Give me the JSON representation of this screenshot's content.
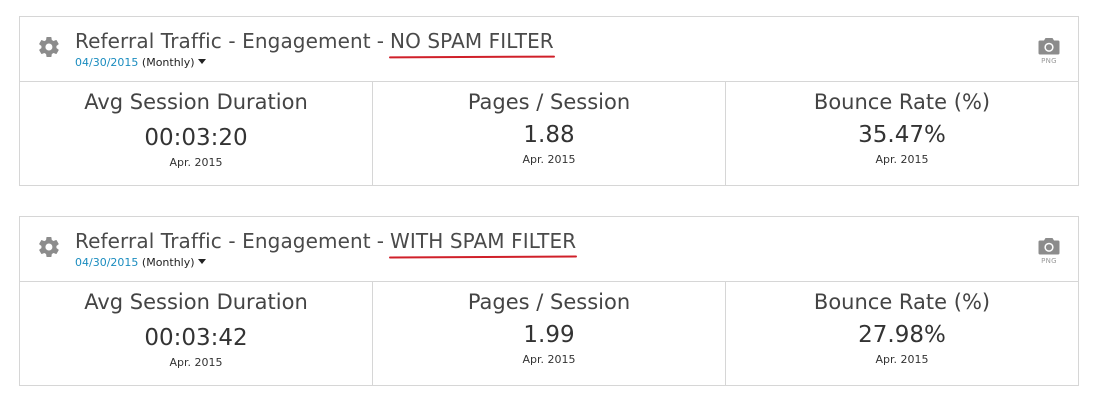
{
  "widgets": [
    {
      "title_prefix": "Referral Traffic - Engagement",
      "separator": "-",
      "title_filter": "NO SPAM FILTER",
      "date": "04/30/2015",
      "period": "(Monthly)",
      "export_label": "PNG",
      "metrics": [
        {
          "label": "Avg Session Duration",
          "value": "00:03:20",
          "date": "Apr. 2015"
        },
        {
          "label": "Pages / Session",
          "value": "1.88",
          "date": "Apr. 2015"
        },
        {
          "label": "Bounce Rate (%)",
          "value": "35.47%",
          "date": "Apr. 2015"
        }
      ]
    },
    {
      "title_prefix": "Referral Traffic - Engagement",
      "separator": "-",
      "title_filter": "WITH SPAM FILTER",
      "date": "04/30/2015",
      "period": "(Monthly)",
      "export_label": "PNG",
      "metrics": [
        {
          "label": "Avg Session Duration",
          "value": "00:03:42",
          "date": "Apr. 2015"
        },
        {
          "label": "Pages / Session",
          "value": "1.99",
          "date": "Apr. 2015"
        },
        {
          "label": "Bounce Rate (%)",
          "value": "27.98%",
          "date": "Apr. 2015"
        }
      ]
    }
  ],
  "colors": {
    "accent_link": "#1a8cbf",
    "highlight_underline": "#d0202a",
    "border": "#d6d6d6",
    "icon_gray": "#8c8c8c"
  },
  "icons": {
    "settings": "gear-icon",
    "export": "camera-icon",
    "dropdown": "caret-down-icon"
  }
}
